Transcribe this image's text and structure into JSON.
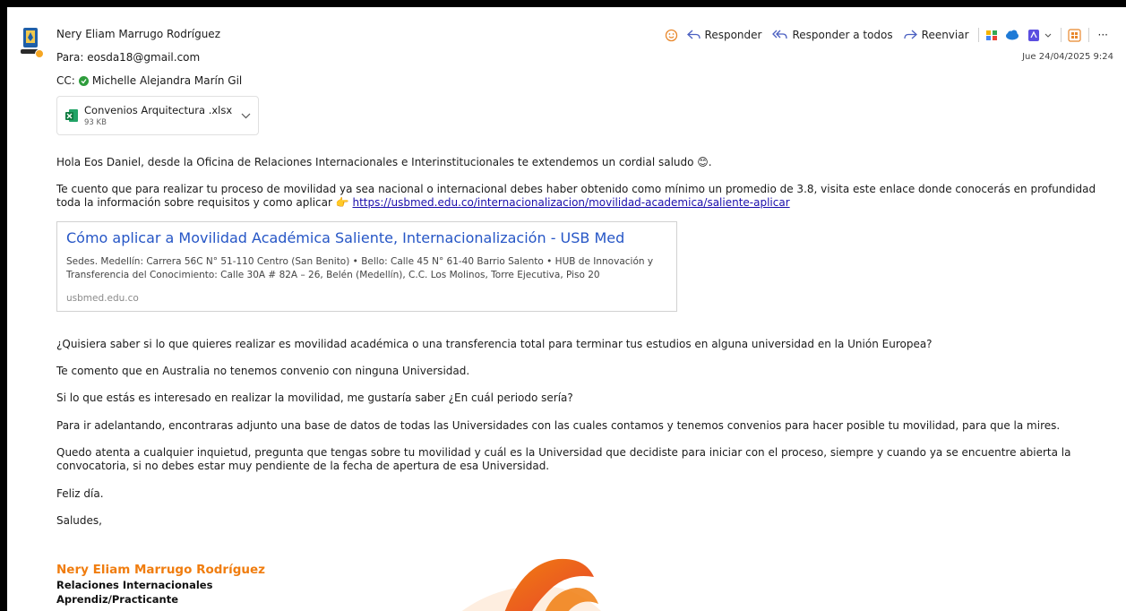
{
  "header": {
    "sender": "Nery Eliam Marrugo Rodríguez",
    "to_label": "Para:",
    "to_value": "eosda18@gmail.com",
    "cc_label": "CC:",
    "cc_value": "Michelle Alejandra Marín Gil",
    "date": "Jue 24/04/2025 9:24"
  },
  "toolbar": {
    "reply": "Responder",
    "reply_all": "Responder a todos",
    "forward": "Reenviar",
    "more": "···"
  },
  "attachment": {
    "name": "Convenios Arquitectura .xlsx",
    "size": "93 KB",
    "icon": "excel-icon"
  },
  "body": {
    "p1": "Hola Eos Daniel, desde la Oficina de Relaciones Internacionales e Interinstitucionales te extendemos un cordial saludo 😊.",
    "p2a": "Te cuento que para realizar tu proceso de movilidad ya sea nacional o internacional debes haber obtenido como mínimo un promedio de 3.8, visita este enlace donde conocerás en profundidad toda la información sobre requisitos y como aplicar 👉 ",
    "p2_link": "https://usbmed.edu.co/internacionalizacion/movilidad-academica/saliente-aplicar",
    "p3": "¿Quisiera saber si lo que quieres realizar es movilidad académica o una transferencia total para terminar tus estudios en alguna universidad en la Unión Europea?",
    "p4": "Te comento que en Australia no tenemos convenio con ninguna Universidad.",
    "p5": "Si lo que estás es interesado en realizar la movilidad, me gustaría saber ¿En cuál periodo sería?",
    "p6": "Para ir adelantando, encontraras adjunto una base de datos de todas las Universidades con las cuales contamos y tenemos convenios para hacer posible tu movilidad, para que la mires.",
    "p7": "Quedo atenta a cualquier inquietud, pregunta que tengas sobre tu movilidad y cuál es la Universidad que decidiste para iniciar con el proceso, siempre y cuando ya se encuentre abierta la convocatoria, si no debes estar muy pendiente de la fecha de apertura de esa Universidad.",
    "p8": "Feliz día.",
    "p9": "Saludes,"
  },
  "link_card": {
    "title": "Cómo aplicar a Movilidad Académica Saliente, Internacionalización - USB Med",
    "description": "Sedes. Medellín: Carrera 56C N° 51-110 Centro (San Benito) • Bello: Calle 45 N° 61-40 Barrio Salento • HUB de Innovación y Transferencia del Conocimiento: Calle 30A # 82A – 26, Belén (Medellín), C.C. Los Molinos, Torre Ejecutiva, Piso 20",
    "site": "usbmed.edu.co"
  },
  "signature": {
    "name": "Nery Eliam Marrugo Rodríguez",
    "line1": "Relaciones Internacionales",
    "line2": "Aprendiz/Practicante"
  },
  "colors": {
    "accent": "#f07d0f",
    "link": "#1a0dab",
    "card_title": "#2656c6"
  }
}
